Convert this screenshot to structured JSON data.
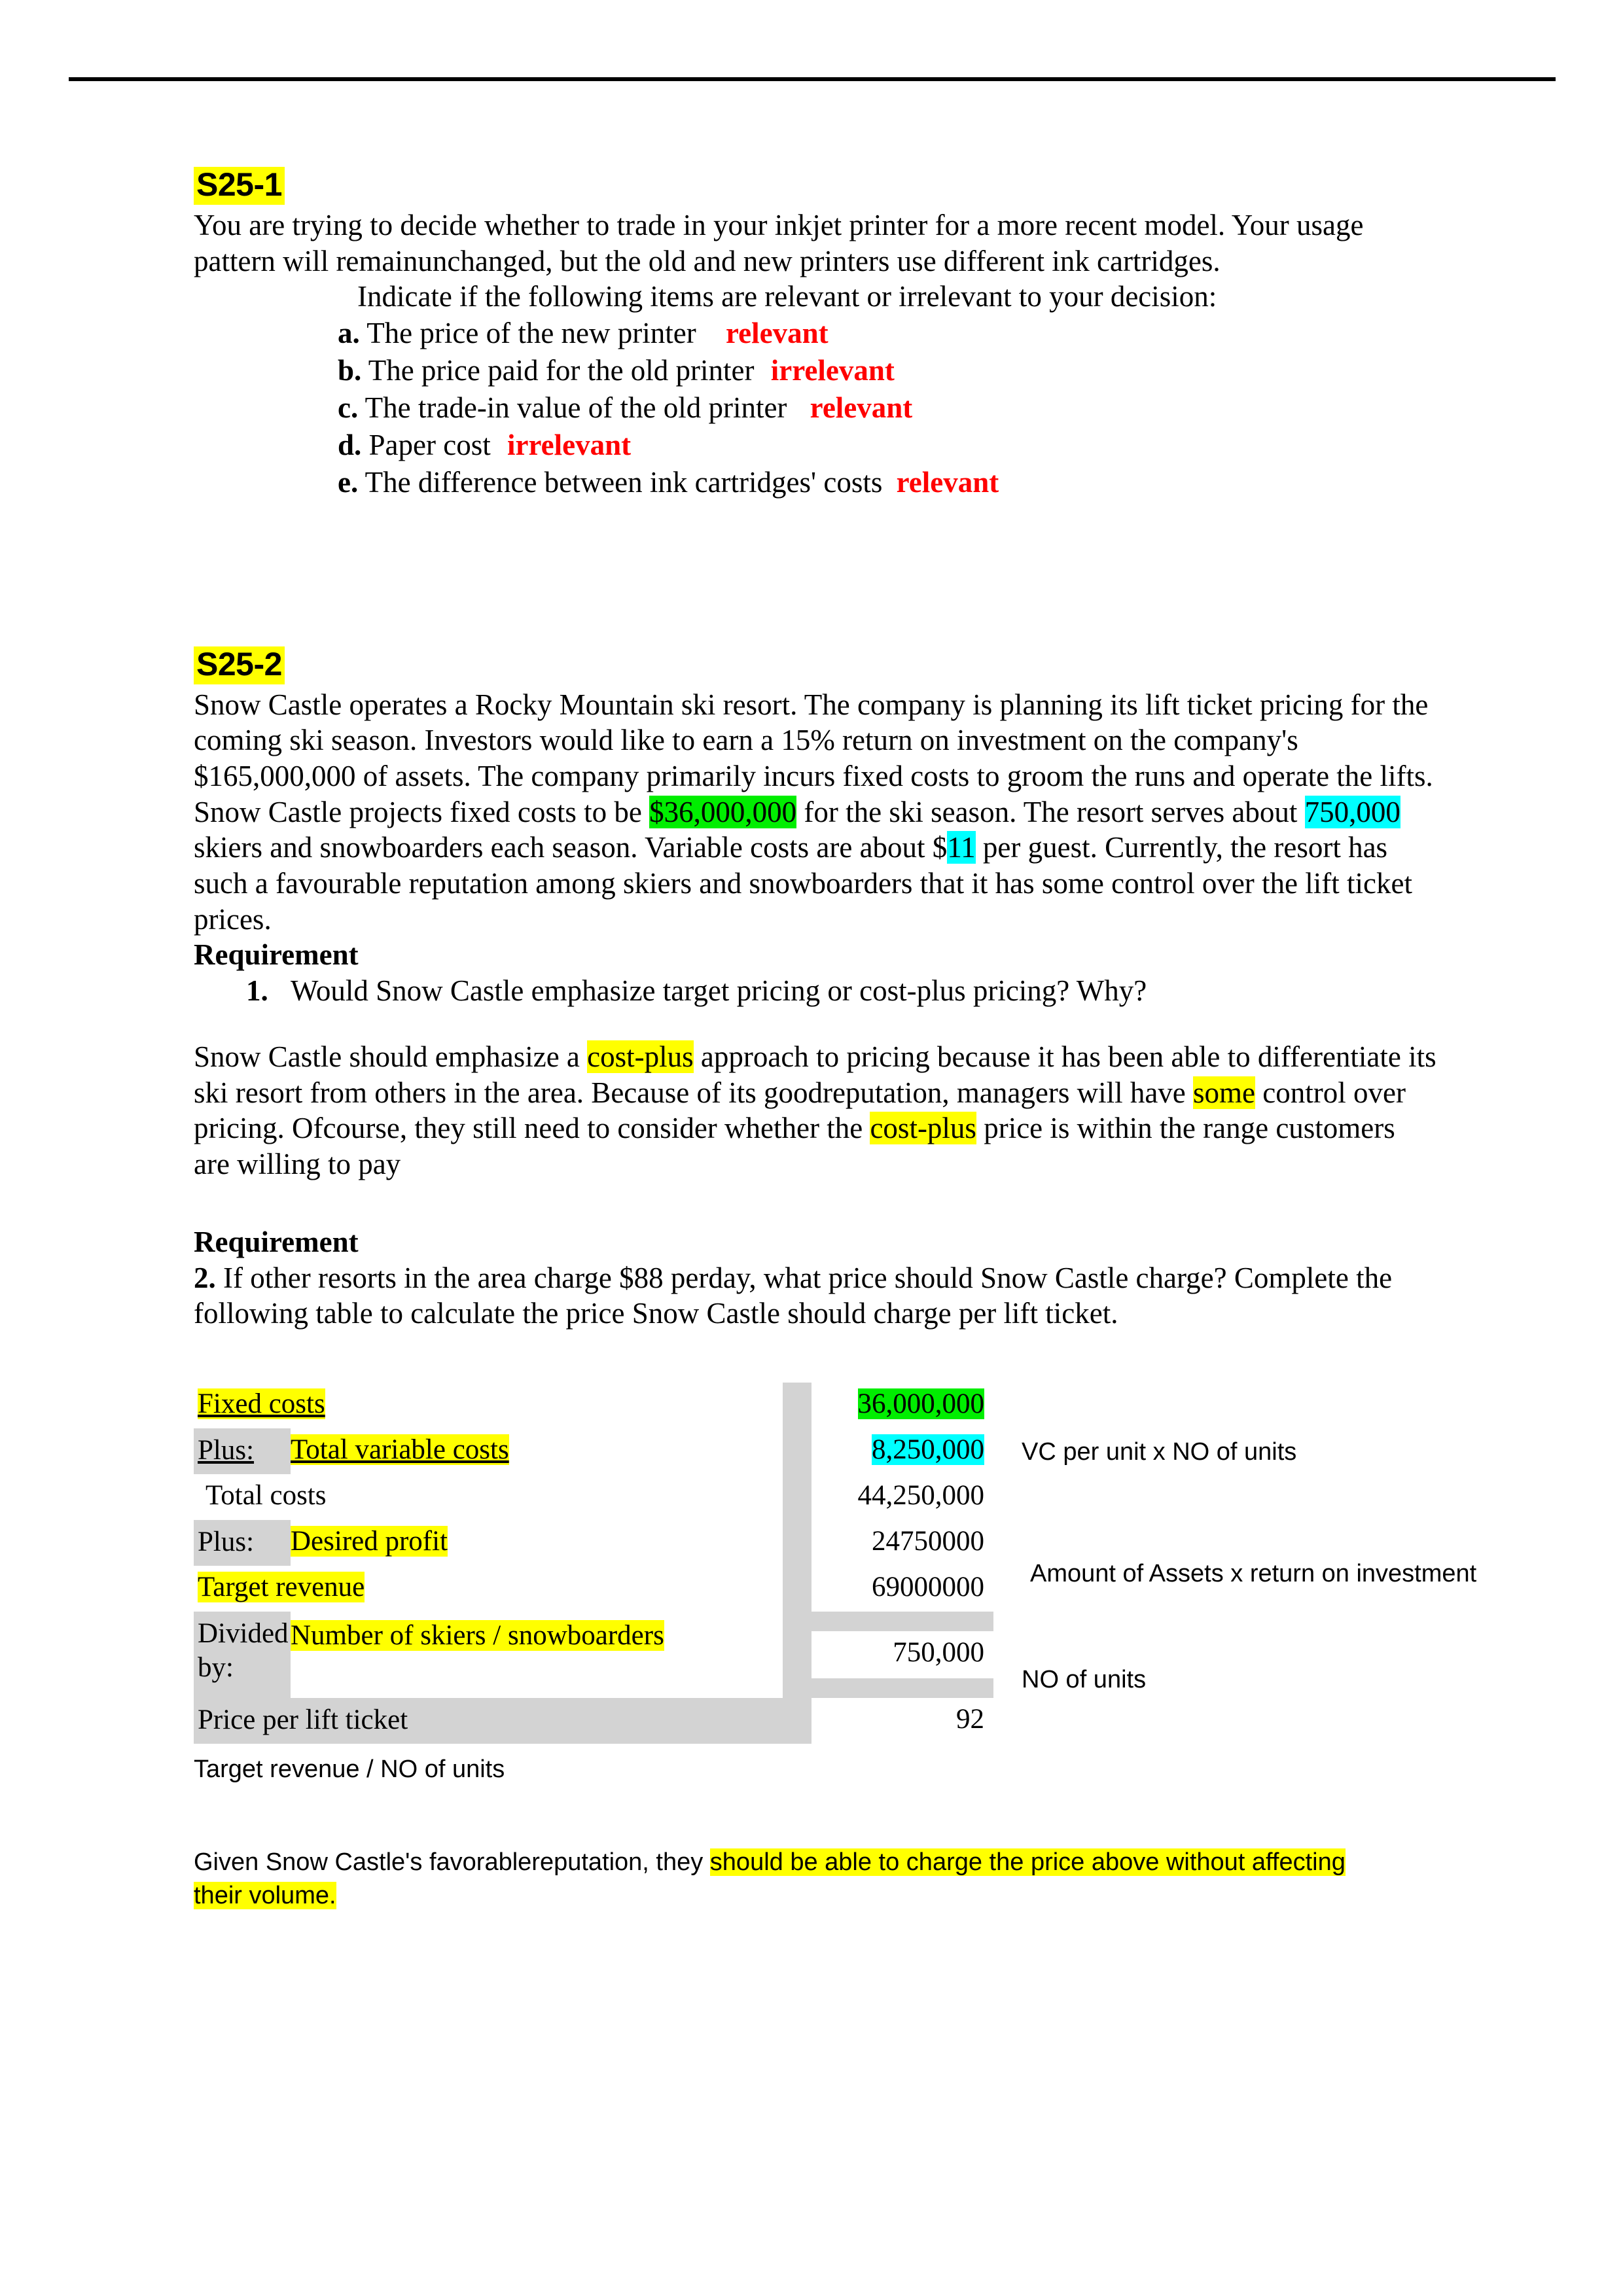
{
  "document": {
    "header_rule": true
  },
  "s25_1": {
    "heading": "S25-1",
    "intro_line1": "You are trying to decide whether to trade in your inkjet printer for a more recent model. Your",
    "intro_line2": "usage pattern will remainunchanged, but the old and new printers use different ink cartridges.",
    "instruction": "Indicate if the following items are relevant or irrelevant to your decision:",
    "items": [
      {
        "letter": "a.",
        "text": "The price of the new printer",
        "answer": "relevant"
      },
      {
        "letter": "b.",
        "text": "The price paid for the old printer",
        "answer": "irrelevant"
      },
      {
        "letter": "c.",
        "text": "The trade-in value of the old printer",
        "answer": "relevant"
      },
      {
        "letter": "d.",
        "text": "Paper cost",
        "answer": "irrelevant"
      },
      {
        "letter": "e.",
        "text": "The difference between ink cartridges' costs",
        "answer": "relevant"
      }
    ]
  },
  "s25_2": {
    "heading": "S25-2",
    "body": {
      "t1": "Snow Castle operates a Rocky Mountain ski resort. The company is planning its lift ticket pricing for the coming ski season. Investors would like to earn a 15% return on investment on the company's $165,000,000 of assets. The company primarily incurs fixed costs to groom the runs and operate the lifts. Snow Castle projects fixed costs to be ",
      "fixed_costs_hl": "$36,000,000",
      "t2": " for the ski season. The resort serves about ",
      "skiers_hl": "750,000",
      "t3": " skiers and snowboarders each season. Variable costs are about $",
      "vc_hl": "11",
      "t4": " per guest. Currently, the resort has such a favourable reputation among skiers and snowboarders that it has some control over the lift ticket prices."
    },
    "requirement1": {
      "label": "Requirement",
      "number": "1.",
      "question": "Would Snow Castle emphasize target pricing or cost-plus pricing? Why?"
    },
    "answer1": {
      "a1": "Snow Castle should emphasize a ",
      "hl1": "cost-plus",
      "a2": " approach to pricing because it has been able to differentiate its ski resort from others in the area. Because of its goodreputation, managers will have ",
      "hl2": "some",
      "a3": " control over pricing. Ofcourse, they still need to consider whether the ",
      "hl3": "cost-plus",
      "a4": " price is within the range customers are willing to pay"
    },
    "requirement2": {
      "label": "Requirement",
      "number": "2.",
      "line1": "If other resorts in the area charge $88 perday, what price should Snow Castle charge?",
      "line2": "Complete the following table to calculate the price Snow Castle should charge per lift ticket."
    }
  },
  "calc_table": {
    "rows": [
      {
        "prefix": "",
        "label": "Fixed costs",
        "value": "36,000,000",
        "label_hl": "yellow",
        "value_hl": "green",
        "label_underline": true
      },
      {
        "prefix": "Plus:",
        "label": "Total variable costs",
        "value": "8,250,000",
        "label_hl": "yellow",
        "value_hl": "cyan",
        "label_underline": true
      },
      {
        "prefix": "",
        "label": "Total costs",
        "value": "44,250,000",
        "label_hl": "none",
        "value_hl": "none",
        "label_underline": false
      },
      {
        "prefix": "Plus:",
        "label": "Desired profit",
        "value": "24750000",
        "label_hl": "yellow",
        "value_hl": "none",
        "label_underline": false
      },
      {
        "prefix": "",
        "label": "Target revenue",
        "value": "69000000",
        "label_hl": "yellow",
        "value_hl": "none",
        "label_underline": false
      },
      {
        "prefix": "Divided by:",
        "label": "Number of skiers / snowboarders",
        "value": "750,000",
        "label_hl": "yellow",
        "value_hl": "none",
        "label_underline": false
      },
      {
        "prefix": "",
        "label": "Price per lift ticket",
        "value": "92",
        "label_hl": "none",
        "value_hl": "none",
        "label_underline": false
      }
    ]
  },
  "annotations": {
    "note_vc": "VC per unit x NO of units",
    "note_assets": "Amount of Assets x return on investment",
    "note_units": "NO of units",
    "note_below_table": "Target revenue / NO of units"
  },
  "final_note": {
    "plain": "Given Snow Castle's favorablereputation, they ",
    "highlight": "should be able to charge the price above without affecting their volume."
  },
  "colors": {
    "yellow": "#ffff00",
    "green": "#00ee00",
    "cyan": "#00ffff",
    "red": "#ff0000",
    "table_bg": "#d3d3d3",
    "cell_bg": "#ffffff"
  }
}
